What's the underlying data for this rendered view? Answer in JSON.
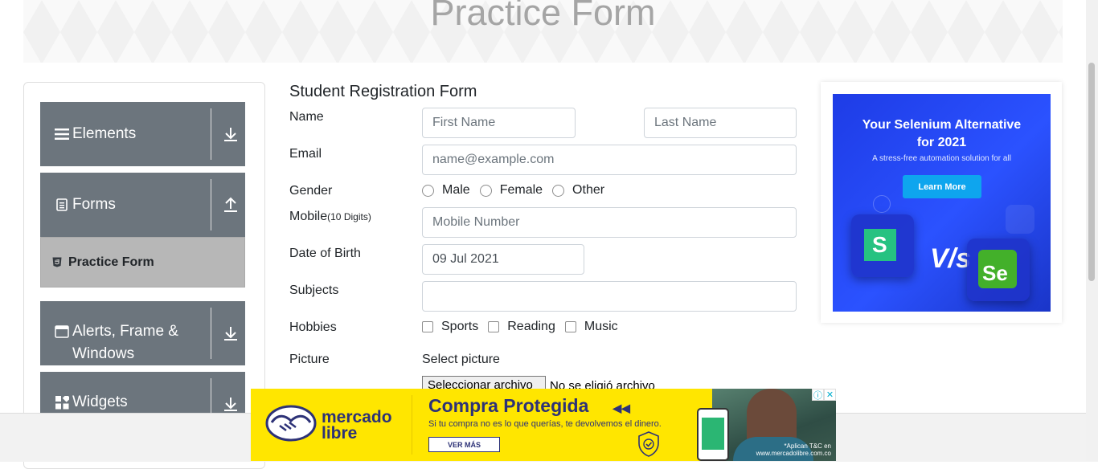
{
  "header": {
    "title": "Practice Form"
  },
  "sidebar": {
    "groups": [
      {
        "label": "Elements",
        "icon": "menu-lines-icon",
        "arrow": "arrow-down-icon"
      },
      {
        "label": "Forms",
        "icon": "document-icon",
        "arrow": "arrow-up-icon"
      },
      {
        "label": "Alerts, Frame &",
        "label2": "Windows",
        "icon": "window-icon",
        "arrow": "arrow-down-icon"
      },
      {
        "label": "Widgets",
        "icon": "widgets-icon",
        "arrow": "arrow-down-icon"
      }
    ],
    "active_item": {
      "label": "Practice Form",
      "icon": "html5-icon"
    }
  },
  "form": {
    "title": "Student Registration Form",
    "name_label": "Name",
    "first_name_placeholder": "First Name",
    "last_name_placeholder": "Last Name",
    "email_label": "Email",
    "email_placeholder": "name@example.com",
    "gender_label": "Gender",
    "gender_options": [
      "Male",
      "Female",
      "Other"
    ],
    "mobile_label": "Mobile",
    "mobile_hint": "(10 Digits)",
    "mobile_placeholder": "Mobile Number",
    "dob_label": "Date of Birth",
    "dob_value": "09 Jul 2021",
    "subjects_label": "Subjects",
    "hobbies_label": "Hobbies",
    "hobbies_options": [
      "Sports",
      "Reading",
      "Music"
    ],
    "picture_label": "Picture",
    "select_picture_label": "Select picture",
    "file_button": "Seleccionar archivo",
    "file_status": "No se eligió archivo"
  },
  "side_ad": {
    "headline": "Your Selenium Alternative",
    "headline2": "for 2021",
    "subline": "A stress-free automation solution for all",
    "button": "Learn More",
    "vs_text": "V/s",
    "left_logo": "S",
    "right_logo": "Se",
    "colors": {
      "bg": "#2b52ff",
      "button": "#0ea5ee"
    }
  },
  "bottom_ad": {
    "brand_line1": "mercado",
    "brand_line2": "libre",
    "title": "Compra Protegida",
    "tagline": "Si tu compra no es lo que querías, te devolvemos el dinero.",
    "cta": "VER MÁS",
    "terms_line1": "*Aplican T&C en",
    "terms_line2": "www.mercadolibre.com.co",
    "colors": {
      "bg": "#ffe600",
      "text": "#2d3277"
    }
  }
}
